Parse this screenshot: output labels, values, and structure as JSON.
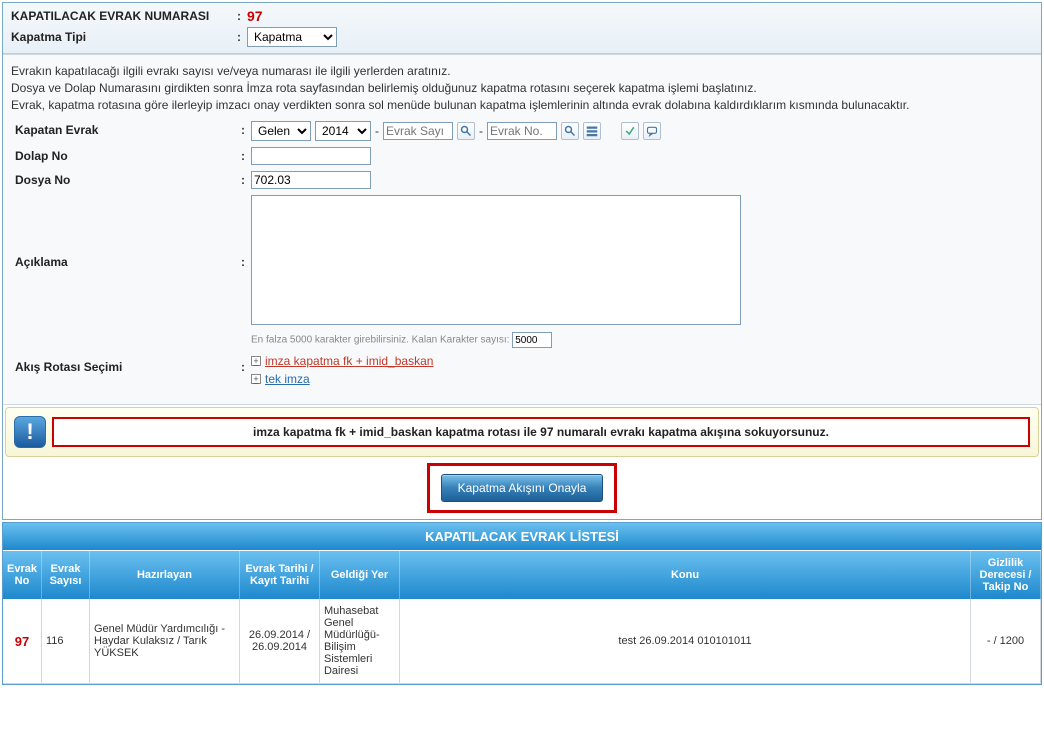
{
  "header": {
    "kapatilacak_label": "KAPATILACAK EVRAK NUMARASI",
    "evrak_no": "97",
    "kapatma_tipi_label": "Kapatma Tipi",
    "kapatma_tipi_value": "Kapatma"
  },
  "instructions": {
    "line1": "Evrakın kapatılacağı ilgili evrakı sayısı ve/veya numarası ile ilgili yerlerden aratınız.",
    "line2": "Dosya ve Dolap Numarasını girdikten sonra İmza rota sayfasından belirlemiş olduğunuz kapatma rotasını seçerek kapatma işlemi başlatınız.",
    "line3": "Evrak, kapatma rotasına göre ilerleyip imzacı onay verdikten sonra sol menüde bulunan kapatma işlemlerinin altında evrak dolabına kaldırdıklarım kısmında bulunacaktır."
  },
  "form": {
    "kapatan_evrak_label": "Kapatan Evrak",
    "direction_value": "Gelen",
    "year_value": "2014",
    "dash": "-",
    "sayi_placeholder": "Evrak Sayı",
    "no_placeholder": "Evrak No.",
    "dolap_no_label": "Dolap No",
    "dolap_no_value": "",
    "dosya_no_label": "Dosya No",
    "dosya_no_value": "702.03",
    "aciklama_label": "Açıklama",
    "aciklama_value": "",
    "char_hint_prefix": "En falza 5000 karakter girebilirsiniz. Kalan Karakter sayısı:",
    "char_remaining": "5000",
    "akis_rota_label": "Akış Rotası Seçimi",
    "rota1": "imza kapatma fk + imid_baskan",
    "rota2": "tek imza"
  },
  "alert": {
    "message": "imza kapatma fk + imid_baskan kapatma rotası ile 97 numaralı evrakı kapatma akışına sokuyorsunuz."
  },
  "confirm": {
    "button_label": "Kapatma Akışını Onayla"
  },
  "list": {
    "title": "KAPATILACAK EVRAK LİSTESİ",
    "columns": {
      "no": "Evrak No",
      "sayi": "Evrak Sayısı",
      "hazir": "Hazırlayan",
      "tarih": "Evrak Tarihi / Kayıt Tarihi",
      "yer": "Geldiği Yer",
      "konu": "Konu",
      "gizlilik": "Gizlilik Derecesi / Takip No"
    },
    "rows": [
      {
        "no": "97",
        "sayi": "116",
        "hazir": "Genel Müdür Yardımcılığı - Haydar Kulaksız / Tarık YÜKSEK",
        "tarih": "26.09.2014 / 26.09.2014",
        "yer": "Muhasebat Genel Müdürlüğü-Bilişim Sistemleri Dairesi",
        "konu": "test 26.09.2014 010101011",
        "gizlilik": "- / 1200"
      }
    ]
  }
}
